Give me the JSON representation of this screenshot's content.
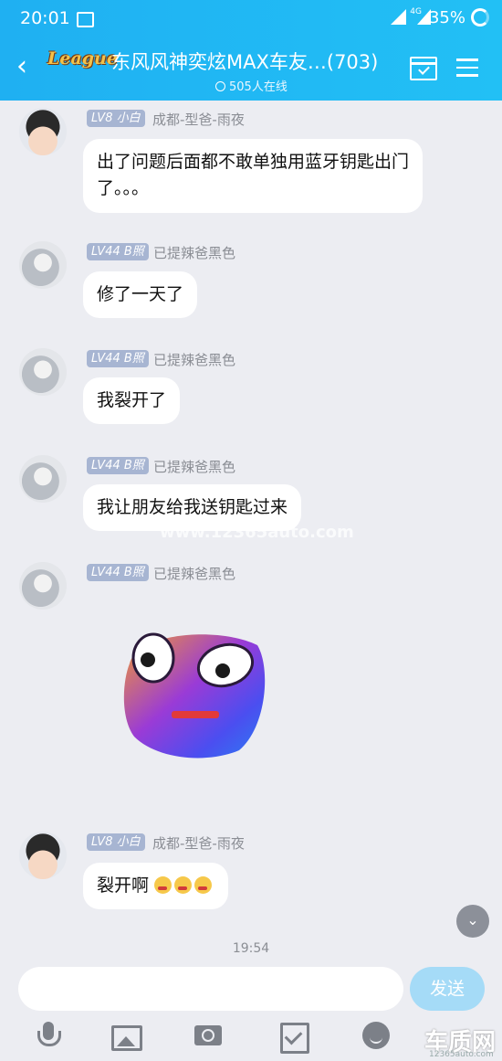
{
  "status": {
    "time": "20:01",
    "network": "4G",
    "battery": "35%"
  },
  "header": {
    "logo": "League",
    "title": "东风风神奕炫MAX车友…(703)",
    "online": "505人在线"
  },
  "messages": [
    {
      "level": "LV8 小白",
      "nick": "成都-型爸-雨夜",
      "text": "出了问题后面都不敢单独用蓝牙钥匙出门了。。。"
    },
    {
      "level": "LV44 B照",
      "nick": "已提辣爸黑色",
      "text": "修了一天了"
    },
    {
      "level": "LV44 B照",
      "nick": "已提辣爸黑色",
      "text": "我裂开了"
    },
    {
      "level": "LV44 B照",
      "nick": "已提辣爸黑色",
      "text": "我让朋友给我送钥匙过来"
    },
    {
      "level": "LV44 B照",
      "nick": "已提辣爸黑色"
    },
    {
      "level": "LV8 小白",
      "nick": "成都-型爸-雨夜",
      "text": "裂开啊"
    }
  ],
  "watermark_mid": "www.12365auto.com",
  "time_separator": "19:54",
  "input": {
    "placeholder": "",
    "send_label": "发送"
  },
  "watermark": {
    "brand": "车质网",
    "url": "12365auto.com"
  },
  "colors": {
    "header": "#1fb0f2",
    "level_tag": "#a7b5d2",
    "send": "#a5dbf7"
  }
}
